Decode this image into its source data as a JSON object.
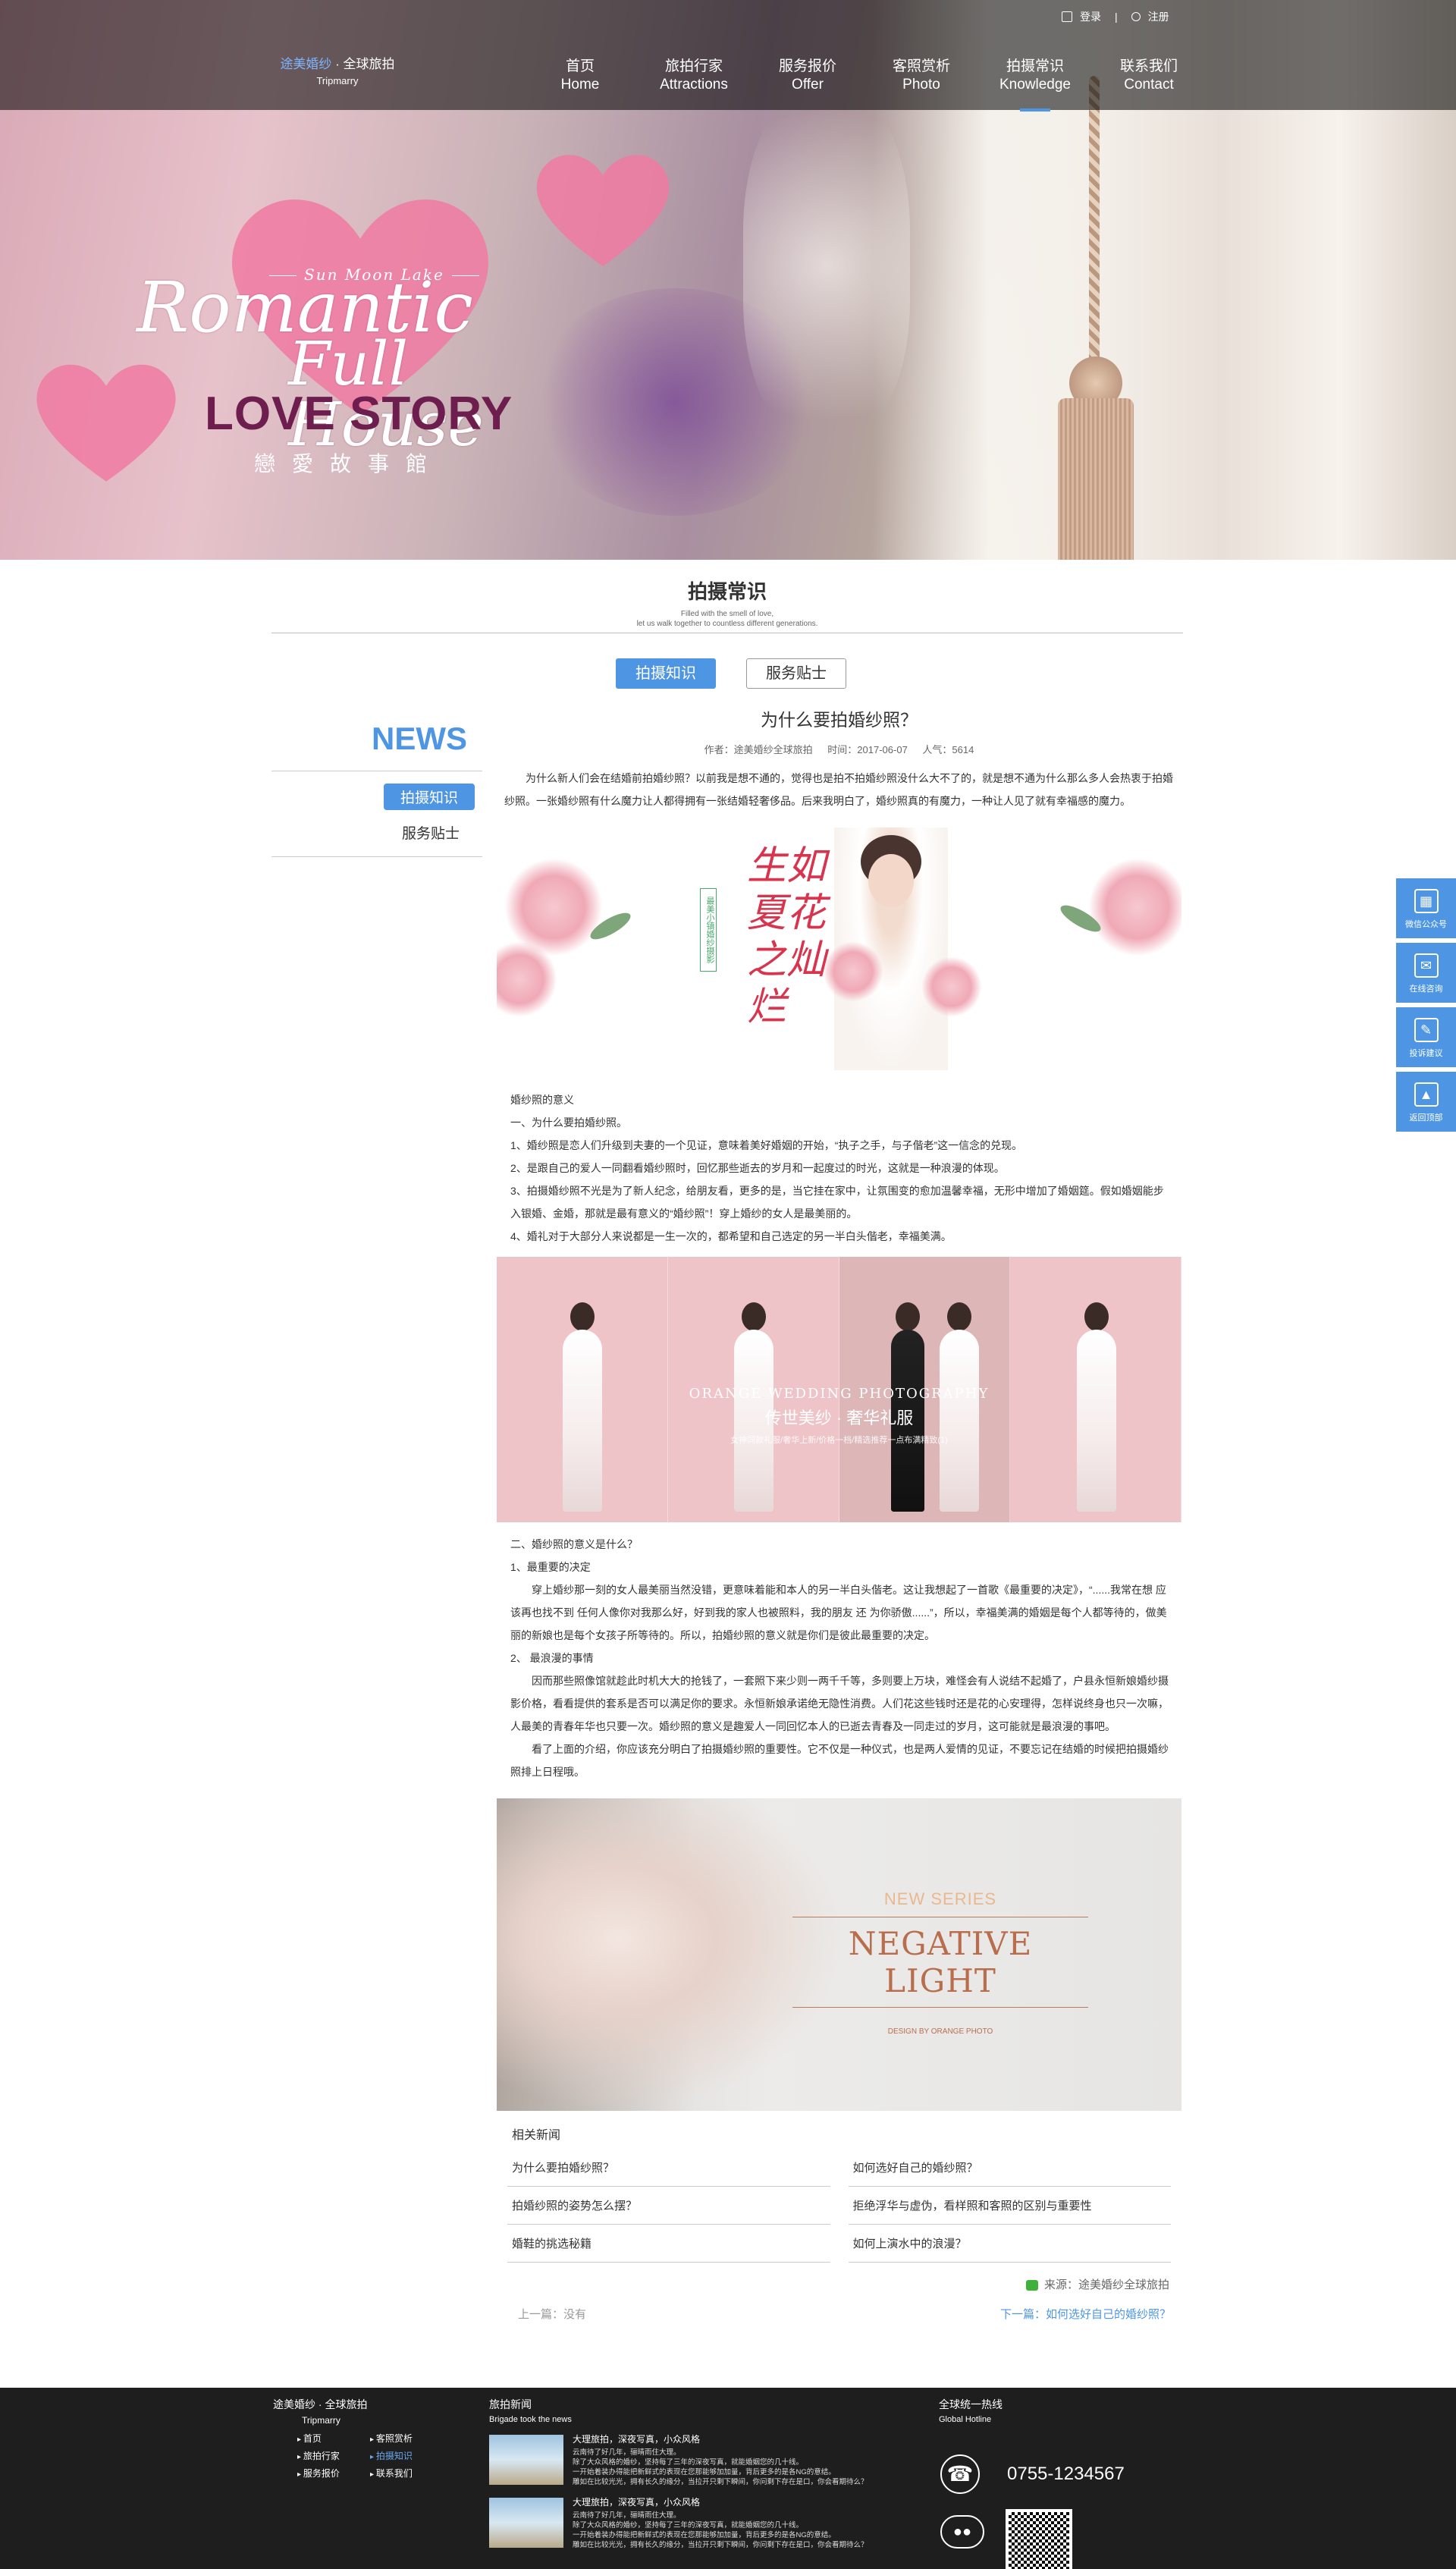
{
  "header": {
    "logo_main": "途美婚纱",
    "logo_sep": " · 全球旅拍",
    "logo_en": "Tripmarry",
    "login": "登录",
    "divider": "|",
    "register": "注册",
    "nav": [
      {
        "cn": "首页",
        "en": "Home"
      },
      {
        "cn": "旅拍行家",
        "en": "Attractions"
      },
      {
        "cn": "服务报价",
        "en": "Offer"
      },
      {
        "cn": "客照赏析",
        "en": "Photo"
      },
      {
        "cn": "拍摄常识",
        "en": "Knowledge"
      },
      {
        "cn": "联系我们",
        "en": "Contact"
      }
    ]
  },
  "hero": {
    "sun_moon": "Sun Moon Lake",
    "romantic": "Romantic",
    "full_house": "Full House",
    "love_story": "LOVE STORY",
    "hall": "戀愛故事館"
  },
  "section": {
    "title": "拍摄常识",
    "sub1": "Filled with the smell of love,",
    "sub2": "let us walk together to countless different generations."
  },
  "tabs": [
    "拍摄知识",
    "服务贴士"
  ],
  "sidebar": {
    "news": "NEWS",
    "items": [
      "拍摄知识",
      "服务贴士"
    ]
  },
  "article": {
    "title": "为什么要拍婚纱照？",
    "author": "作者：途美婚纱全球旅拍",
    "time": "时间：2017-06-07",
    "views": "人气：5614",
    "intro": "为什么新人们会在结婚前拍婚纱照？以前我是想不通的，觉得也是拍不拍婚纱照没什么大不了的，就是想不通为什么那么多人会热衷于拍婚纱照。一张婚纱照有什么魔力让人都得拥有一张结婚轻奢侈品。后来我明白了，婚纱照真的有魔力，一种让人见了就有幸福感的魔力。",
    "img1_calligraphy": "生如夏花之灿烂",
    "img1_seal": "最美小镇婚纱摄影",
    "sec1": [
      "婚纱照的意义",
      "一、为什么要拍婚纱照。",
      "1、婚纱照是恋人们升级到夫妻的一个见证，意味着美好婚姻的开始，“执子之手，与子偕老”这一信念的兑现。",
      "2、是跟自己的爱人一同翻看婚纱照时，回忆那些逝去的岁月和一起度过的时光，这就是一种浪漫的体现。",
      "3、拍摄婚纱照不光是为了新人纪念，给朋友看，更多的是，当它挂在家中，让氛围变的愈加温馨幸福，无形中增加了婚姻筵。假如婚姻能步入银婚、金婚，那就是最有意义的“婚纱照”！穿上婚纱的女人是最美丽的。",
      "4、婚礼对于大部分人来说都是一生一次的，都希望和自己选定的另一半白头偕老，幸福美满。"
    ],
    "img2_c1": "ORANGE WEDDING PHOTOGRAPHY",
    "img2_c2": "传世美纱 · 奢华礼服",
    "img2_c3": "女神同款礼服/奢华上新/价格一档/精选推荐一点布满精致(1)",
    "sec2_head": [
      "二、婚纱照的意义是什么？",
      "1、最重要的决定"
    ],
    "sec2_p1": "穿上婚纱那一刻的女人最美丽当然没错，更意味着能和本人的另一半白头偕老。这让我想起了一首歌《最重要的决定》，“......我常在想 应该再也找不到 任何人像你对我那么好，好到我的家人也被照料，我的朋友 还 为你骄傲......”，所以，幸福美满的婚姻是每个人都等待的，做美丽的新娘也是每个女孩子所等待的。所以，拍婚纱照的意义就是你们是彼此最重要的决定。",
    "sec2_h2": "2、 最浪漫的事情",
    "sec2_p2": "因而那些照像馆就趁此时机大大的抢钱了，一套照下来少则一两千千等，多则要上万块，难怪会有人说结不起婚了，户县永恒新娘婚纱摄影价格，看看提供的套系是否可以满足你的要求。永恒新娘承诺绝无隐性消费。人们花这些钱时还是花的心安理得，怎样说终身也只一次嘛，人最美的青春年华也只要一次。婚纱照的意义是趣爱人一同回忆本人的已逝去青春及一同走过的岁月，这可能就是最浪漫的事吧。",
    "sec2_p3": "看了上面的介绍，你应该充分明白了拍摄婚纱照的重要性。它不仅是一种仪式，也是两人爱情的见证，不要忘记在结婚的时候把拍摄婚纱照排上日程哦。",
    "img3_s1": "NEW SERIES",
    "img3_s2": "NEGATIVE LIGHT",
    "img3_s3": "DESIGN BY ORANGE PHOTO",
    "related_title": "相关新闻",
    "related": [
      "为什么要拍婚纱照？",
      "如何选好自己的婚纱照？",
      "拍婚纱照的姿势怎么摆？",
      "拒绝浮华与虚伪，看样照和客照的区别与重要性",
      "婚鞋的挑选秘籍",
      "如何上演水中的浪漫？"
    ],
    "source": "来源：途美婚纱全球旅拍",
    "prev": "上一篇：没有",
    "next": "下一篇：如何选好自己的婚纱照？"
  },
  "float_bar": [
    "微信公众号",
    "在线咨询",
    "投诉建议",
    "返回顶部"
  ],
  "footer": {
    "logo": "途美婚纱 · 全球旅拍",
    "logo_en": "Tripmarry",
    "links": [
      "首页",
      "客照赏析",
      "旅拍行家",
      "拍摄知识",
      "服务报价",
      "联系我们"
    ],
    "news_title": "旅拍新闻",
    "news_en": "Brigade took the news",
    "news": [
      {
        "head": "大理旅拍，深夜写真，小众风格",
        "l1": "云南待了好几年，骊晴雨住大理。",
        "l2": "除了大众风格的婚纱，坚持每了三年的深夜写真，就能婚姻您的几十线。",
        "l3": "一开始着装办得能把新鲜式的表现在您那能够加加量，背后更多的是各NG的意结。",
        "l4": "雕如在比较光光，拥有长久的缘分，当拉开只剩下瞬间，你问剩下存在是口，你会看期待么？"
      },
      {
        "head": "大理旅拍，深夜写真，小众风格",
        "l1": "云南待了好几年，骊晴雨住大理。",
        "l2": "除了大众风格的婚纱，坚持每了三年的深夜写真，就能婚姻您的几十线。",
        "l3": "一开始着装办得能把新鲜式的表现在您那能够加加量，背后更多的是各NG的意结。",
        "l4": "雕如在比较光光，拥有长久的缘分，当拉开只剩下瞬间，你问剩下存在是口，你会看期待么？"
      }
    ],
    "hotline_title": "全球统一热线",
    "hotline_en": "Global Hotline",
    "phone": "0755-1234567"
  },
  "colors": {
    "accent": "#4e96e4",
    "footer_bg": "#1e1e1e",
    "love_story": "#6d1e4e"
  }
}
